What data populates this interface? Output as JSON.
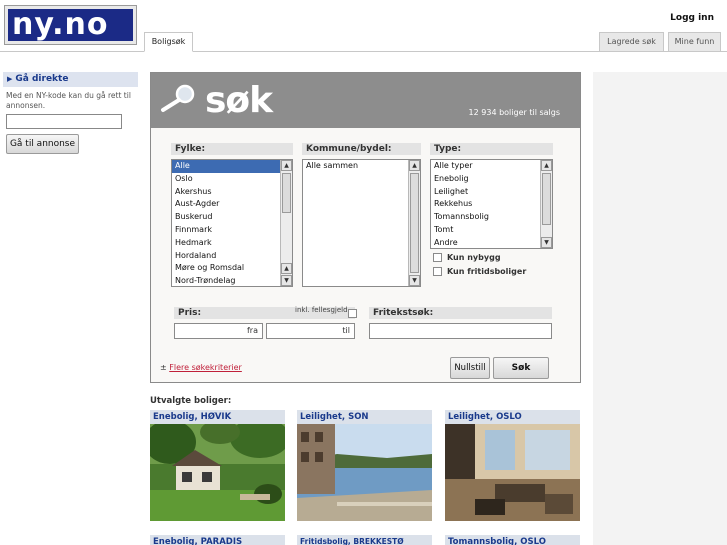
{
  "header": {
    "logo_text": "ny.no",
    "login_label": "Logg inn",
    "tabs": [
      {
        "label": "Boligsøk",
        "active": true
      },
      {
        "label": "Lagrede søk",
        "active": false
      },
      {
        "label": "Mine funn",
        "active": false
      }
    ]
  },
  "sidebar": {
    "heading": "Gå direkte",
    "description": "Med en NY-kode kan du gå rett til annonsen.",
    "input_value": "",
    "button_label": "Gå til annonse"
  },
  "search": {
    "title": "søk",
    "listing_count": "12 934 boliger til salgs",
    "fylke": {
      "label": "Fylke:",
      "options": [
        "Alle",
        "Oslo",
        "Akershus",
        "Aust-Agder",
        "Buskerud",
        "Finnmark",
        "Hedmark",
        "Hordaland",
        "Møre og Romsdal",
        "Nord-Trøndelag"
      ],
      "selected": "Alle"
    },
    "kommune": {
      "label": "Kommune/bydel:",
      "options": [
        "Alle sammen"
      ]
    },
    "type": {
      "label": "Type:",
      "options": [
        "Alle typer",
        "Enebolig",
        "Leilighet",
        "Rekkehus",
        "Tomannsbolig",
        "Tomt",
        "Andre"
      ]
    },
    "checkboxes": {
      "nybygg": "Kun nybygg",
      "fritid": "Kun fritidsboliger"
    },
    "price": {
      "label": "Pris:",
      "inkl_label": "inkl. fellesgjeld",
      "from_placeholder": "fra",
      "to_placeholder": "til"
    },
    "fritekst": {
      "label": "Fritekstsøk:",
      "value": ""
    },
    "more_criteria": "Flere søkekriterier",
    "reset_label": "Nullstill",
    "search_label": "Søk"
  },
  "featured": {
    "title": "Utvalgte boliger:",
    "cards": [
      {
        "label": "Enebolig, HØVIK"
      },
      {
        "label": "Leilighet, SON"
      },
      {
        "label": "Leilighet, OSLO"
      },
      {
        "label": "Enebolig, PARADIS"
      },
      {
        "label": "Fritidsbolig, BREKKESTØ"
      },
      {
        "label": "Tomannsbolig, OSLO"
      }
    ]
  },
  "colors": {
    "brand_blue": "#1b2a86",
    "panel_header_grey": "#8d8d8d",
    "selected_blue": "#3d6bb2",
    "link_red": "#c0203a"
  }
}
